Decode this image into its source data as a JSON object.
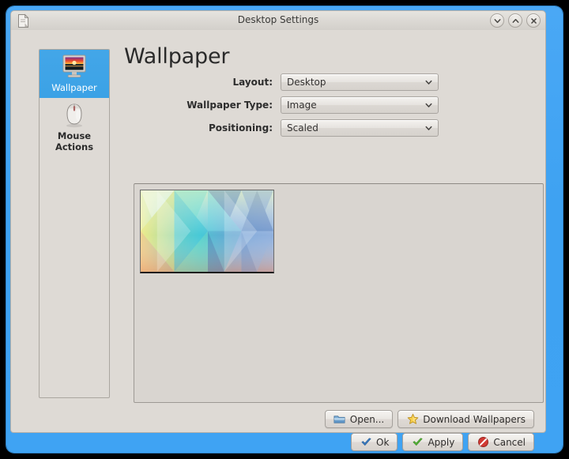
{
  "window": {
    "title": "Desktop Settings",
    "menu_icon": "document-icon",
    "controls": [
      {
        "name": "shade-button",
        "icon": "chevron-down-icon",
        "glyph": "⌄"
      },
      {
        "name": "keep-above-button",
        "icon": "chevron-up-icon",
        "glyph": "⌃"
      },
      {
        "name": "close-button",
        "icon": "close-icon",
        "glyph": "×"
      }
    ]
  },
  "sidebar": {
    "items": [
      {
        "label": "Wallpaper",
        "icon": "monitor-wallpaper-icon",
        "selected": true
      },
      {
        "label": "Mouse Actions",
        "icon": "mouse-icon",
        "selected": false
      }
    ]
  },
  "main": {
    "title": "Wallpaper",
    "fields": [
      {
        "label": "Layout:",
        "value": "Desktop",
        "name": "layout"
      },
      {
        "label": "Wallpaper Type:",
        "value": "Image",
        "name": "wallpaper-type"
      },
      {
        "label": "Positioning:",
        "value": "Scaled",
        "name": "positioning"
      }
    ],
    "wallpaper_preview": {
      "name": "geometric-triangles-wallpaper",
      "selected": true
    }
  },
  "buttons": {
    "open": {
      "label": "Open...",
      "icon": "folder-open-icon"
    },
    "download": {
      "label": "Download Wallpapers",
      "icon": "star-icon"
    },
    "ok": {
      "label": "Ok",
      "icon": "check-blue-icon"
    },
    "apply": {
      "label": "Apply",
      "icon": "check-green-icon"
    },
    "cancel": {
      "label": "Cancel",
      "icon": "cancel-red-icon"
    }
  },
  "colors": {
    "frame_blue": "#3fa3f3",
    "selection_blue": "#3ba2e6",
    "dialog_bg": "#dedad5",
    "titlebar_bg": "#ddd9d4"
  }
}
